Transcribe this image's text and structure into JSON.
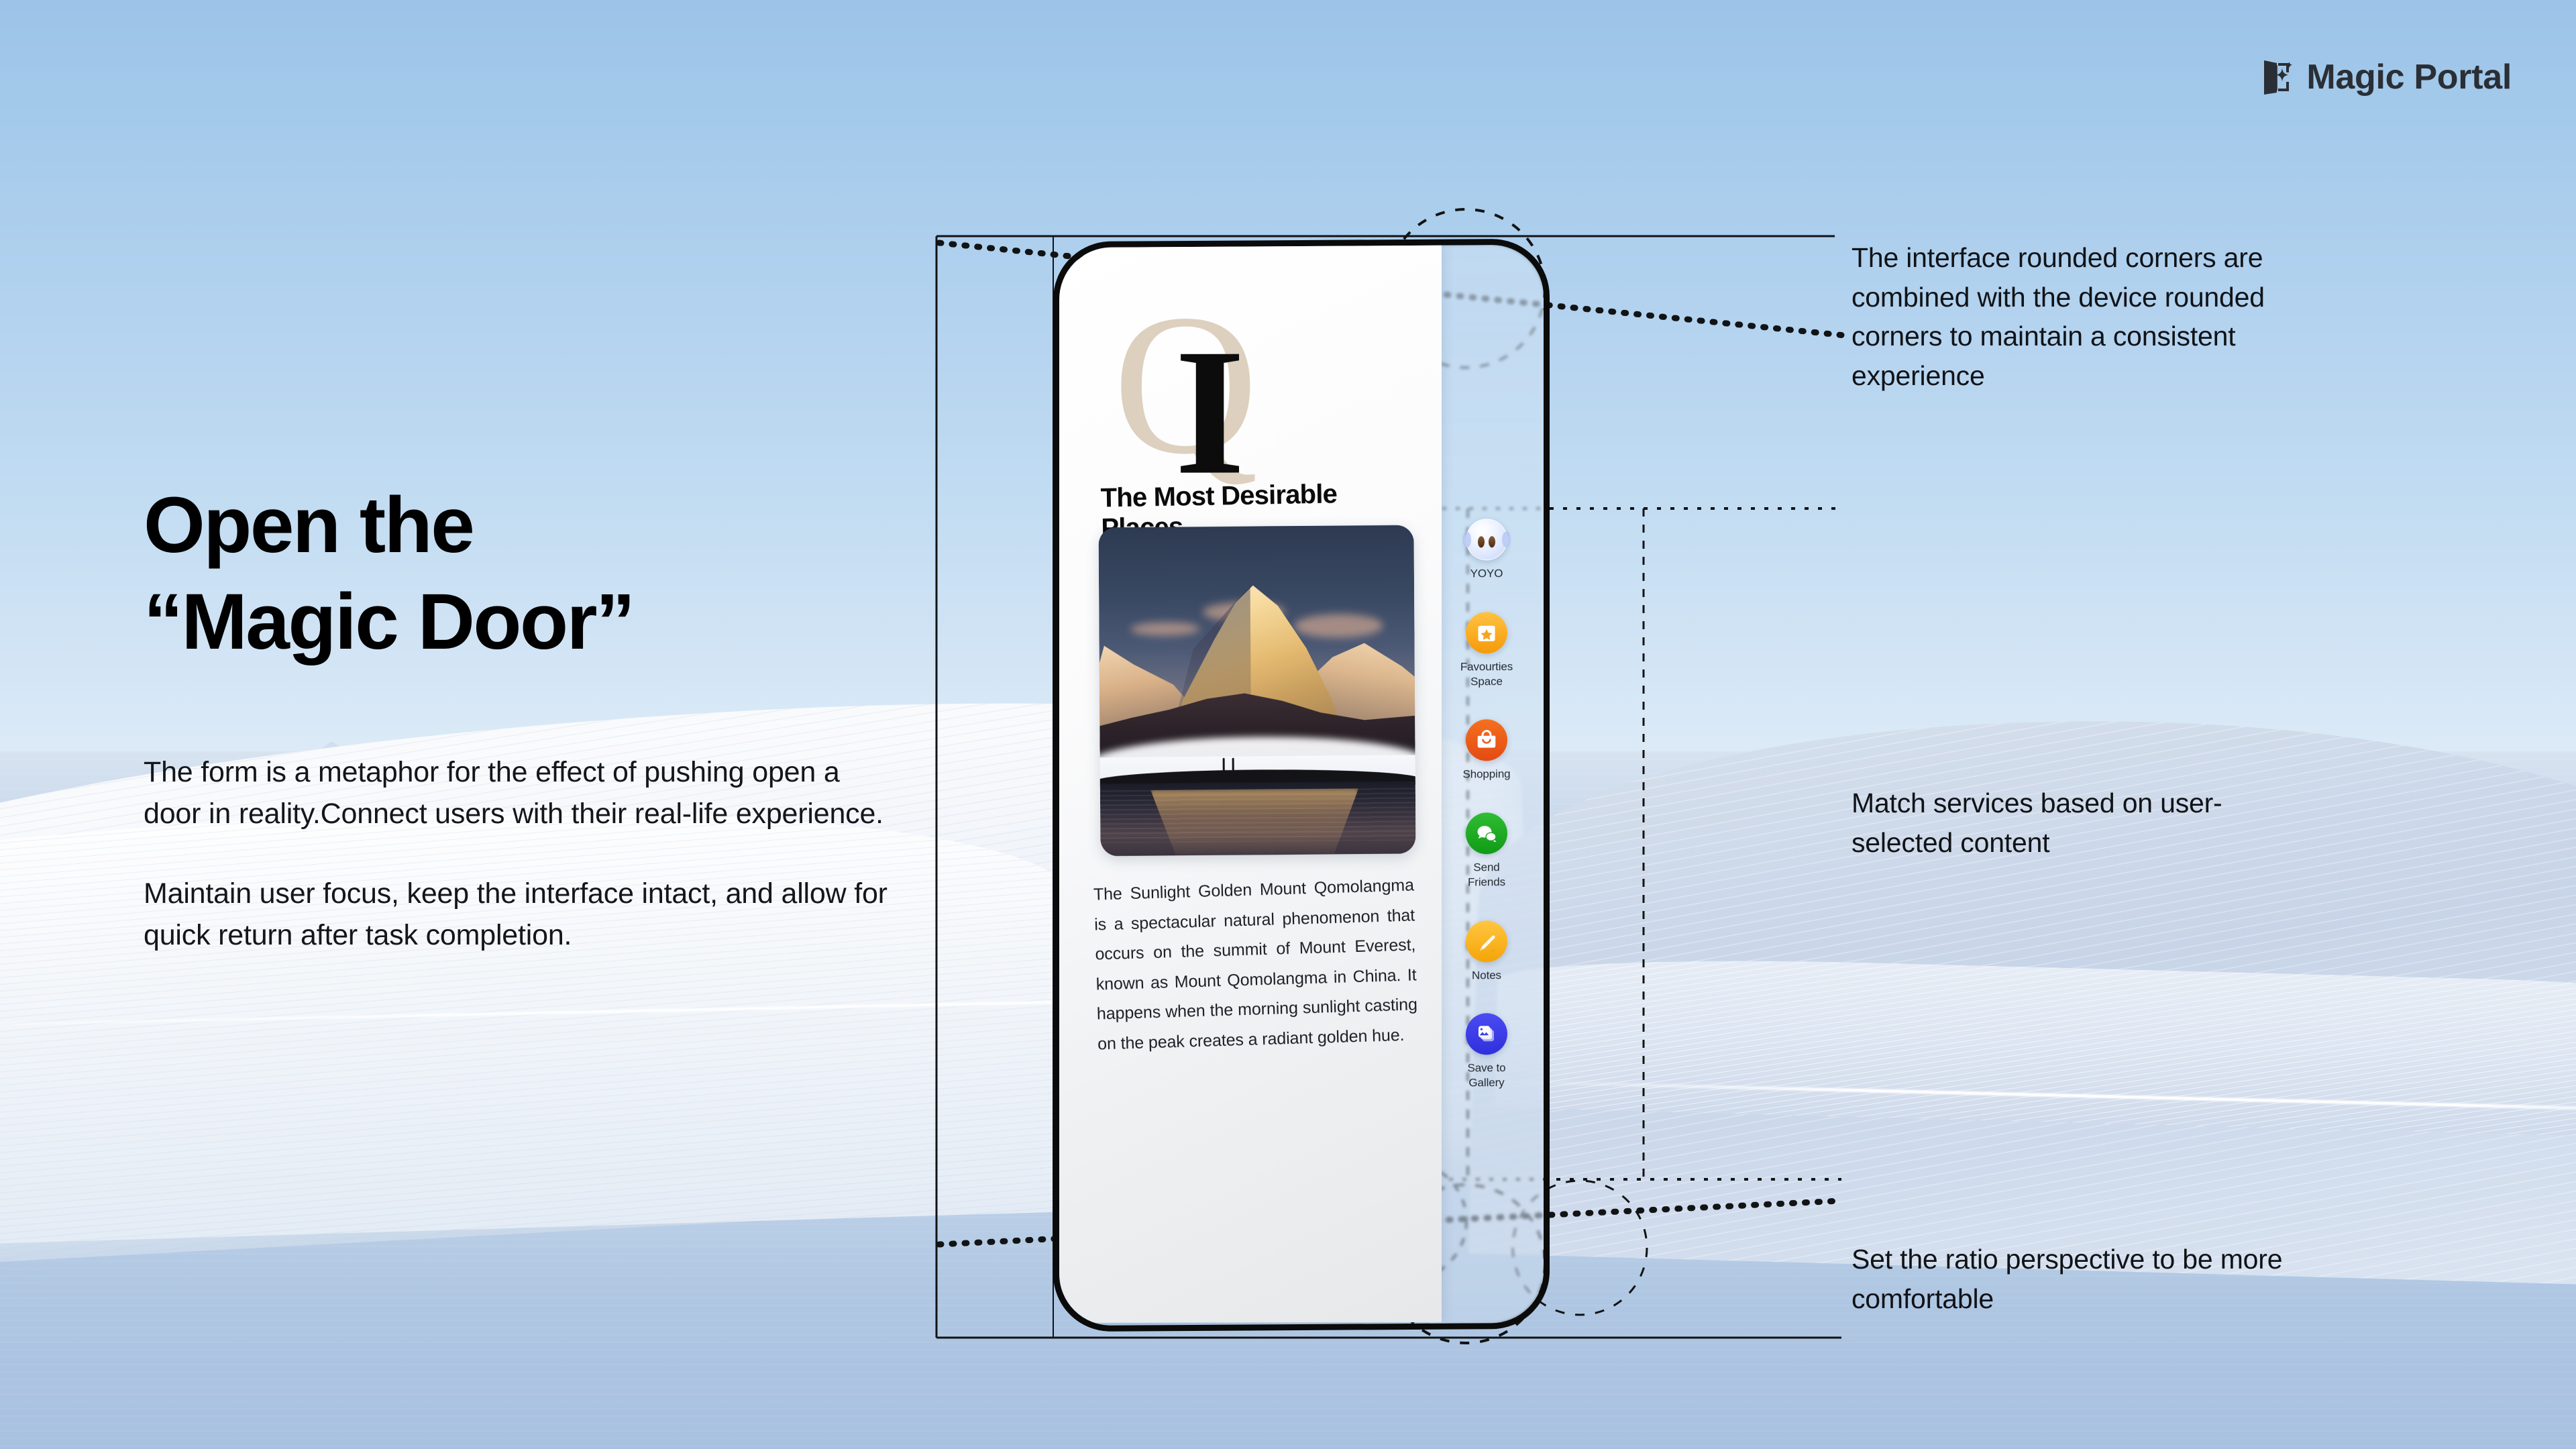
{
  "brand": {
    "name": "Magic Portal",
    "logo_icon": "magic-portal-door-sparkle-icon"
  },
  "headline": {
    "line1": "Open the",
    "line2": "“Magic Door”"
  },
  "body": {
    "paragraph1": "The form is a metaphor for the effect of pushing open a door in reality.Connect users with their real-life experience.",
    "paragraph2": "Maintain user focus, keep the interface intact, and allow for quick return after task completion."
  },
  "annotations": [
    {
      "id": "rounded-corners",
      "text": "The interface rounded corners are combined with the device rounded corners to maintain a consistent experience"
    },
    {
      "id": "match-services",
      "text": "Match services based on user-selected content"
    },
    {
      "id": "ratio-perspective",
      "text": "Set the ratio perspective to be more comfortable"
    }
  ],
  "phone": {
    "card": {
      "dropcap_primary": "Q",
      "dropcap_secondary": "I",
      "title": "The Most Desirable Places",
      "photo_alt": "golden-sunlit-snow-mountain-reflected-in-lake",
      "body": "The Sunlight Golden Mount Qomolangma is a spectacular natural phenomenon that occurs on the summit of Mount Everest, known as Mount Qomolangma in China. It happens when the morning sunlight casting on the peak creates a radiant golden hue."
    },
    "rail": [
      {
        "id": "yoyo",
        "label": "YOYO",
        "icon": "yoyo-assistant-icon",
        "color": "#dbe6ff"
      },
      {
        "id": "favourites-space",
        "label": "Favourties\nSpace",
        "icon": "favourites-star-card-icon",
        "color": "#f7a51d"
      },
      {
        "id": "shopping",
        "label": "Shopping",
        "icon": "shopping-bag-icon",
        "color": "#ef5a1c"
      },
      {
        "id": "send-friends",
        "label": "Send\nFriends",
        "icon": "chat-bubbles-icon",
        "color": "#22a52a"
      },
      {
        "id": "notes",
        "label": "Notes",
        "icon": "pencil-note-icon",
        "color": "#fab515"
      },
      {
        "id": "save-to-gallery",
        "label": "Save to\nGallery",
        "icon": "photo-stack-icon",
        "color": "#3b3ce8"
      }
    ]
  },
  "colors": {
    "sky": "#a8cbec",
    "water": "#b5cfe7",
    "ink": "#101317",
    "frame": "#0b0b0b",
    "dropcap_beige": "#ddd0be"
  }
}
